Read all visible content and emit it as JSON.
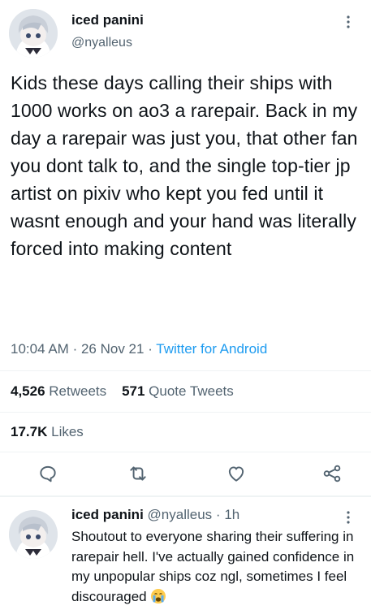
{
  "tweet": {
    "author_name": "iced panini",
    "author_handle": "@nyalleus",
    "text": "Kids these days calling their ships with 1000 works on ao3 a rarepair. Back in my day a rarepair was just you, that other fan you dont talk to, and the single top-tier jp artist on pixiv who kept you fed until it wasnt enough and your hand was literally forced into making content",
    "time": "10:04 AM",
    "date": "26 Nov 21",
    "source": "Twitter for Android",
    "retweets_count": "4,526",
    "retweets_label": "Retweets",
    "quote_count": "571",
    "quote_label": "Quote Tweets",
    "likes_count": "17.7K",
    "likes_label": "Likes"
  },
  "actions": [
    "reply-icon",
    "retweet-icon",
    "like-icon",
    "share-icon"
  ],
  "reply": {
    "author_name": "iced panini",
    "author_handle": "@nyalleus",
    "time_ago": "1h",
    "text": "Shoutout to everyone sharing their suffering in rarepair hell. I've actually gained confidence in my unpopular ships coz ngl, sometimes I feel discouraged",
    "emoji": "crying-face-icon"
  },
  "colors": {
    "text": "#0f1419",
    "secondary": "#536471",
    "link": "#1d9bf0",
    "divider": "#eff3f4"
  }
}
